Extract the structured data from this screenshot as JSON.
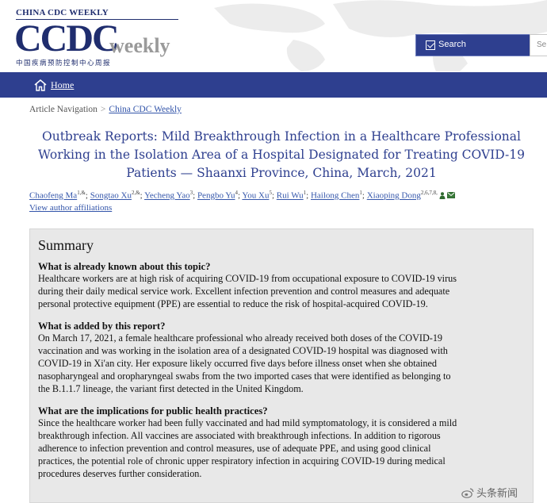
{
  "header": {
    "brand_top": "CHINA CDC WEEKLY",
    "logo_main": "CCDC",
    "logo_sub": "weekly",
    "logo_cn": "中国疾病预防控制中心周报",
    "search_label": "Search",
    "search_placeholder": "Se"
  },
  "nav": {
    "home_label": "Home"
  },
  "breadcrumb": {
    "items": [
      "Article Navigation",
      "China CDC Weekly"
    ],
    "separator": ">"
  },
  "article": {
    "title_lines": [
      "Outbreak Reports: Mild Breakthrough Infection in a Healthcare Professional",
      "Working in the Isolation Area of a Hospital Designated for Treating COVID-19",
      "Patients — Shaanxi Province, China, March, 2021"
    ],
    "authors": [
      {
        "name": "Chaofeng Ma",
        "sup": "1,&"
      },
      {
        "name": "Songtao Xu",
        "sup": "2,&"
      },
      {
        "name": "Yecheng Yao",
        "sup": "3"
      },
      {
        "name": "Pengbo Yu",
        "sup": "4"
      },
      {
        "name": "You Xu",
        "sup": "5"
      },
      {
        "name": "Rui Wu",
        "sup": "1"
      },
      {
        "name": "Hailong Chen",
        "sup": "1"
      },
      {
        "name": "Xiaoping Dong",
        "sup": "2,6,7,8,"
      }
    ],
    "affiliations_link": "View author affiliations"
  },
  "summary": {
    "heading": "Summary",
    "sections": [
      {
        "question": "What is already known about this topic?",
        "answer_lines": [
          "Healthcare workers are at high risk of acquiring COVID-19 from occupational exposure to COVID-19 virus",
          "during their daily medical service work. Excellent infection prevention and control measures and adequate",
          "personal protective equipment (PPE) are essential to reduce the risk of hospital-acquired COVID-19."
        ]
      },
      {
        "question": "What is added by this report?",
        "answer_lines": [
          "On March 17, 2021, a female healthcare professional who already received both doses of the COVID-19",
          "vaccination and was working in the isolation area of a designated COVID-19 hospital was diagnosed with",
          "COVID-19 in Xi'an city. Her exposure likely occurred five days before illness onset when she obtained",
          "nasopharyngeal and oropharyngeal swabs from the two imported cases that were identified as belonging to",
          "the B.1.1.7 lineage, the variant first detected in the United Kingdom."
        ]
      },
      {
        "question": "What are the implications for public health practices?",
        "answer_lines": [
          "Since the healthcare worker had been fully vaccinated and had mild symptomatology, it is considered a mild",
          "breakthrough infection. All vaccines are associated with breakthrough infections. In addition to rigorous",
          "adherence to infection prevention and control measures, use of adequate PPE, and using good clinical",
          "practices, the potential role of chronic upper respiratory infection in acquiring COVID-19 during medical",
          "procedures deserves further consideration."
        ]
      }
    ]
  },
  "watermark": {
    "text": "头条新闻"
  },
  "colors": {
    "brand_navy": "#2e3f8f",
    "link_blue": "#3355aa",
    "summary_bg": "#e8e8e8"
  }
}
